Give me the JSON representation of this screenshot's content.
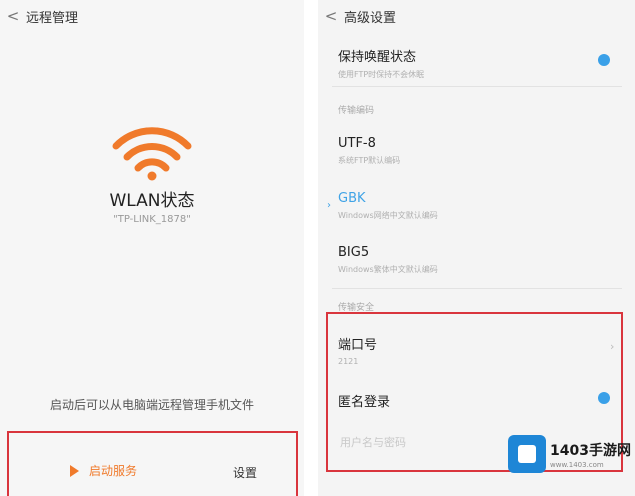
{
  "left": {
    "title": "远程管理",
    "wlan_title": "WLAN状态",
    "ssid": "\"TP-LINK_1878\"",
    "hint": "启动后可以从电脑端远程管理手机文件",
    "start_label": "启动服务",
    "settings_label": "设置"
  },
  "right": {
    "title": "高级设置",
    "keep_awake": {
      "title": "保持唤醒状态",
      "sub": "使用FTP时保持不会休眠"
    },
    "section_encoding": "传输编码",
    "encodings": [
      {
        "title": "UTF-8",
        "sub": "系统FTP默认编码"
      },
      {
        "title": "GBK",
        "sub": "Windows网络中文默认编码"
      },
      {
        "title": "BIG5",
        "sub": "Windows繁体中文默认编码"
      }
    ],
    "section_security": "传输安全",
    "port": {
      "title": "端口号",
      "value": "2121"
    },
    "anonymous": {
      "title": "匿名登录"
    },
    "user_pass_placeholder": "用户名与密码"
  },
  "watermark": {
    "main": "1403手游网",
    "url": "www.1403.com"
  },
  "colors": {
    "accent": "#f07a2b",
    "toggle": "#3aa0e8",
    "highlight_frame": "#d9353d",
    "selected": "#3fa3e6"
  }
}
